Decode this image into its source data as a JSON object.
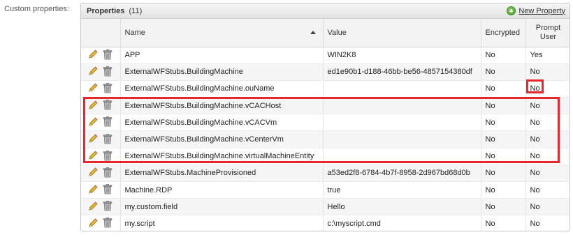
{
  "field_label": "Custom properties:",
  "panel": {
    "title": "Properties",
    "count": "(11)",
    "new_property_label": "New Property"
  },
  "columns": {
    "name": "Name",
    "value": "Value",
    "encrypted": "Encrypted",
    "prompt_user": "Prompt User"
  },
  "rows": [
    {
      "name": "APP",
      "value": "WIN2K8",
      "encrypted": "No",
      "prompt": "Yes"
    },
    {
      "name": "ExternalWFStubs.BuildingMachine",
      "value": "ed1e90b1-d188-46bb-be56-4857154380df",
      "encrypted": "No",
      "prompt": "No"
    },
    {
      "name": "ExternalWFStubs.BuildingMachine.ouName",
      "value": "",
      "encrypted": "No",
      "prompt": "No"
    },
    {
      "name": "ExternalWFStubs.BuildingMachine.vCACHost",
      "value": "",
      "encrypted": "No",
      "prompt": "No"
    },
    {
      "name": "ExternalWFStubs.BuildingMachine.vCACVm",
      "value": "",
      "encrypted": "No",
      "prompt": "No"
    },
    {
      "name": "ExternalWFStubs.BuildingMachine.vCenterVm",
      "value": "",
      "encrypted": "No",
      "prompt": "No"
    },
    {
      "name": "ExternalWFStubs.BuildingMachine.virtualMachineEntity",
      "value": "",
      "encrypted": "No",
      "prompt": "No"
    },
    {
      "name": "ExternalWFStubs.MachineProvisioned",
      "value": "a53ed2f8-6784-4b7f-8958-2d967bd68d0b",
      "encrypted": "No",
      "prompt": "No"
    },
    {
      "name": "Machine.RDP",
      "value": "true",
      "encrypted": "No",
      "prompt": "No"
    },
    {
      "name": "my.custom.field",
      "value": "Hello",
      "encrypted": "No",
      "prompt": "No"
    },
    {
      "name": "my.script",
      "value": "c:\\myscript.cmd",
      "encrypted": "No",
      "prompt": "No"
    }
  ],
  "icons": {
    "edit": "pencil-icon",
    "delete": "trash-icon",
    "add": "plus-circle-icon",
    "sort": "sort-ascending-icon"
  },
  "colors": {
    "highlight": "#e8262b",
    "add_icon": "#3d9a1e",
    "pencil": "#e8b323"
  }
}
